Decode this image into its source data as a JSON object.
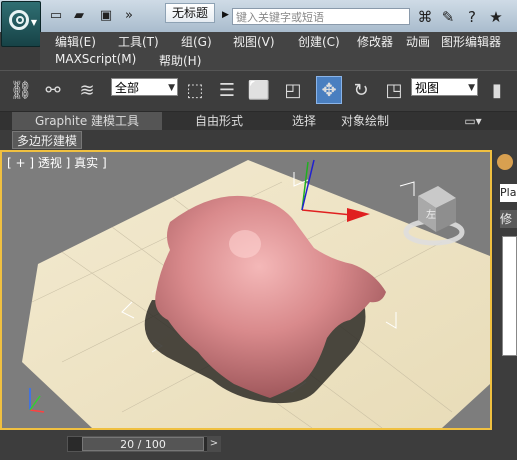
{
  "title_bar": {
    "doc_title": "无标题",
    "search_placeholder": "键入关键字或短语",
    "quick_access_icons": [
      "new-file-icon",
      "open-folder-icon",
      "save-icon",
      "more-icon"
    ],
    "tool_icons": [
      "binoculars-icon",
      "tools-icon",
      "help-icon",
      "star-icon"
    ]
  },
  "menu": {
    "row1": [
      "编辑(E)",
      "工具(T)",
      "组(G)",
      "视图(V)",
      "创建(C)",
      "修改器",
      "动画",
      "图形编辑器"
    ],
    "row2": [
      "MAXScript(M)",
      "帮助(H)"
    ]
  },
  "toolbar": {
    "filter_select": "全部",
    "coord_select": "视图",
    "icons": [
      "link-icon",
      "unlink-icon",
      "bind-spacewarp-icon",
      "select-object-icon",
      "select-by-name-icon",
      "rect-selection-icon",
      "window-crossing-icon",
      "move-icon",
      "rotate-icon",
      "scale-icon",
      "render-icon"
    ]
  },
  "ribbon": {
    "tabs": [
      "Graphite 建模工具",
      "自由形式",
      "选择",
      "对象绘制"
    ],
    "subtab": "多边形建模"
  },
  "viewport": {
    "label": "[ + ] 透视 ] 真实 ]",
    "viewcube_text": "左"
  },
  "right_panel": {
    "field": "Pla",
    "tab_char": "修"
  },
  "timeline": {
    "frame_display": "20 / 100",
    "prev": "<",
    "next": ">"
  }
}
